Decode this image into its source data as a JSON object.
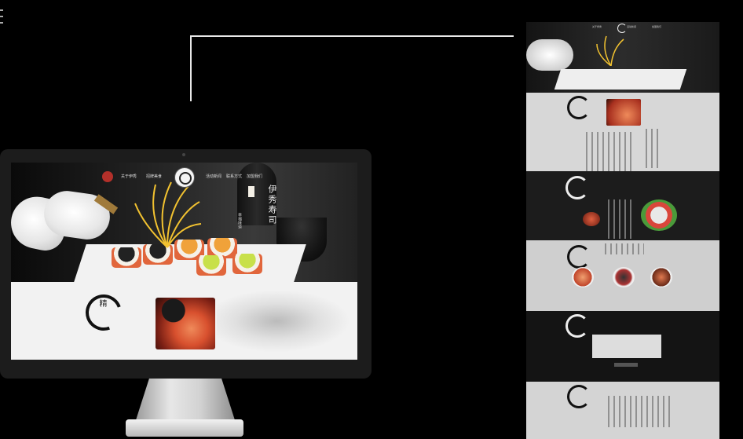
{
  "nav": {
    "items": [
      "关于伊秀",
      "招牌美食",
      "活动新闻",
      "联系方式",
      "加盟我们"
    ]
  },
  "hero": {
    "calligraphy": "伊秀寿司",
    "slogan": "幸福味道"
  },
  "intro": {
    "seal_text": "精"
  },
  "colors": {
    "background": "#000000",
    "connector": "#e8e8e8",
    "logo_red": "#b3302a",
    "section_light": "#f2f2f2"
  },
  "icons": {
    "logo": "brand-logo-icon",
    "seal": "seal-icon"
  }
}
